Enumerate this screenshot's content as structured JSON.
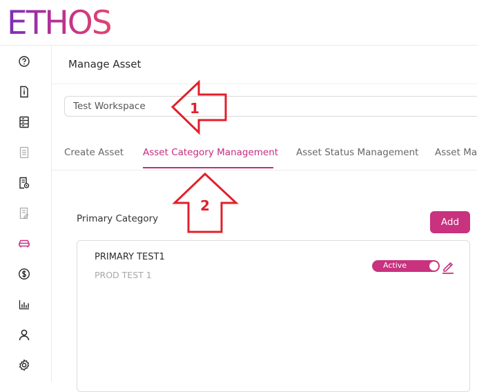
{
  "brand": {
    "logo_text": "ETHOS"
  },
  "page": {
    "title": "Manage Asset"
  },
  "workspace": {
    "value": "Test Workspace"
  },
  "tabs": [
    {
      "label": "Create Asset"
    },
    {
      "label": "Asset Category Management"
    },
    {
      "label": "Asset Status Management"
    },
    {
      "label": "Asset Mai"
    }
  ],
  "section": {
    "title": "Primary Category",
    "add_label": "Add"
  },
  "card": {
    "title": "PRIMARY TEST1",
    "subtitle": "PROD TEST 1",
    "status_label": "Active"
  },
  "annotations": {
    "one": "1",
    "two": "2"
  },
  "sidebar": {
    "icons": [
      "help-circle-icon",
      "info-document-icon",
      "server-icon",
      "list-document-icon",
      "document-settings-icon",
      "document-edit-icon",
      "car-icon",
      "dollar-icon",
      "bar-chart-icon",
      "user-icon",
      "gear-icon"
    ]
  },
  "colors": {
    "accent": "#c8327f",
    "annotation": "#e0202c"
  }
}
